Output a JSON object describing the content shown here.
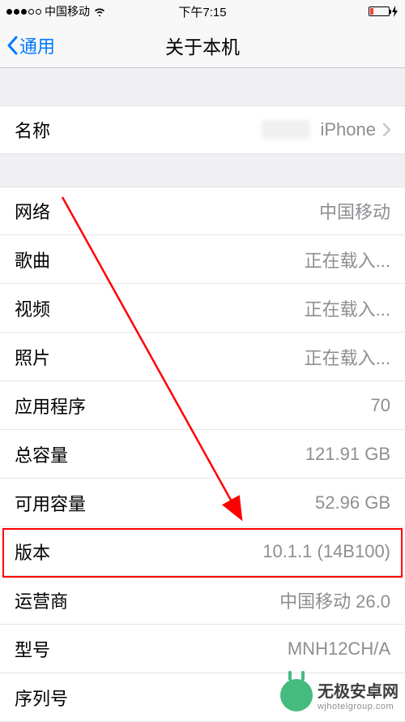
{
  "status": {
    "carrier": "中国移动",
    "time": "下午7:15"
  },
  "nav": {
    "back_label": "通用",
    "title": "关于本机"
  },
  "name_row": {
    "label": "名称",
    "value": "iPhone"
  },
  "rows": [
    {
      "label": "网络",
      "value": "中国移动"
    },
    {
      "label": "歌曲",
      "value": "正在载入..."
    },
    {
      "label": "视频",
      "value": "正在载入..."
    },
    {
      "label": "照片",
      "value": "正在载入..."
    },
    {
      "label": "应用程序",
      "value": "70"
    },
    {
      "label": "总容量",
      "value": "121.91 GB"
    },
    {
      "label": "可用容量",
      "value": "52.96 GB"
    },
    {
      "label": "版本",
      "value": "10.1.1 (14B100)"
    },
    {
      "label": "运营商",
      "value": "中国移动 26.0"
    },
    {
      "label": "型号",
      "value": "MNH12CH/A"
    },
    {
      "label": "序列号",
      "value": ""
    }
  ],
  "watermark": {
    "cn": "无极安卓网",
    "en": "wjhotelgroup.com"
  }
}
